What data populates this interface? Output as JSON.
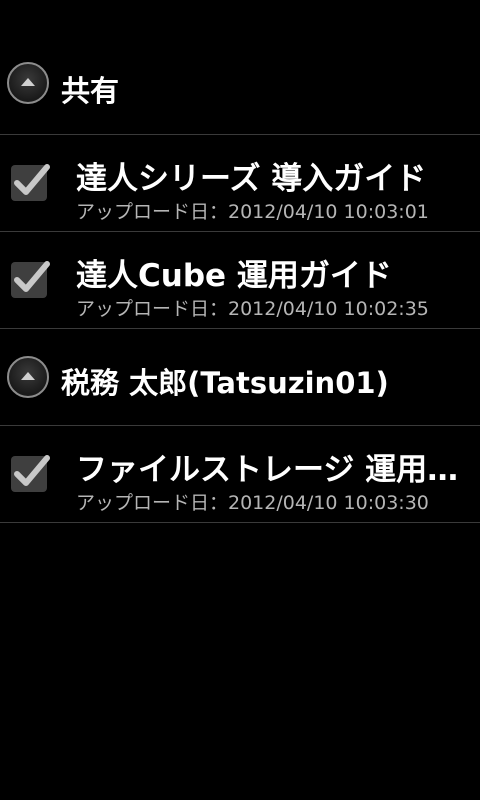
{
  "groups": [
    {
      "title": "共有",
      "items": [
        {
          "title": "達人シリーズ 導入ガイド",
          "subtitle": "アップロード日：2012/04/10 10:03:01",
          "checked": true
        },
        {
          "title": "達人Cube 運用ガイド",
          "subtitle": "アップロード日：2012/04/10 10:02:35",
          "checked": true
        }
      ]
    },
    {
      "title": "税務 太郎(Tatsuzin01)",
      "items": [
        {
          "title": "ファイルストレージ 運用…",
          "subtitle": "アップロード日：2012/04/10 10:03:30",
          "checked": true
        }
      ]
    }
  ],
  "colors": {
    "background": "#000000",
    "divider": "#3a3a3a",
    "subtitle": "#b5b5b5",
    "checkbox": "#3f3f3f",
    "checkmark": "#c8c8c8"
  },
  "icons": {
    "group_toggle": "collapse-arrow-icon",
    "item_check": "checkbox-icon"
  }
}
